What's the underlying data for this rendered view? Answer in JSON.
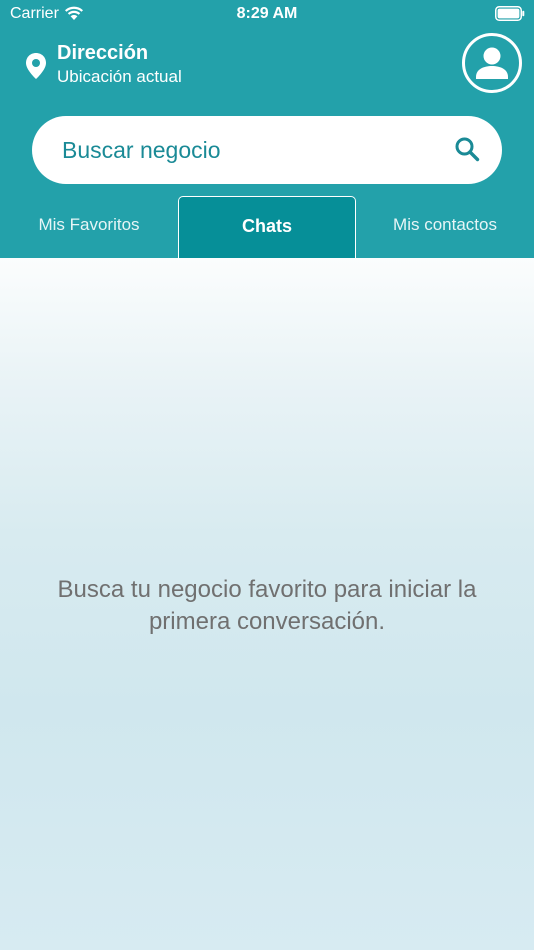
{
  "status_bar": {
    "carrier": "Carrier",
    "time": "8:29 AM"
  },
  "location": {
    "title": "Dirección",
    "subtitle": "Ubicación actual"
  },
  "search": {
    "placeholder": "Buscar negocio"
  },
  "tabs": [
    {
      "label": "Mis Favoritos",
      "active": false
    },
    {
      "label": "Chats",
      "active": true
    },
    {
      "label": "Mis contactos",
      "active": false
    }
  ],
  "empty_state": {
    "message": "Busca tu negocio favorito para iniciar la primera conversación."
  },
  "colors": {
    "header": "#23a1aa",
    "active_tab": "#068f98",
    "accent_text": "#1a8a96",
    "message_text": "#707070"
  },
  "icons": [
    "wifi-icon",
    "battery-icon",
    "location-pin-icon",
    "user-avatar-icon",
    "search-icon"
  ]
}
